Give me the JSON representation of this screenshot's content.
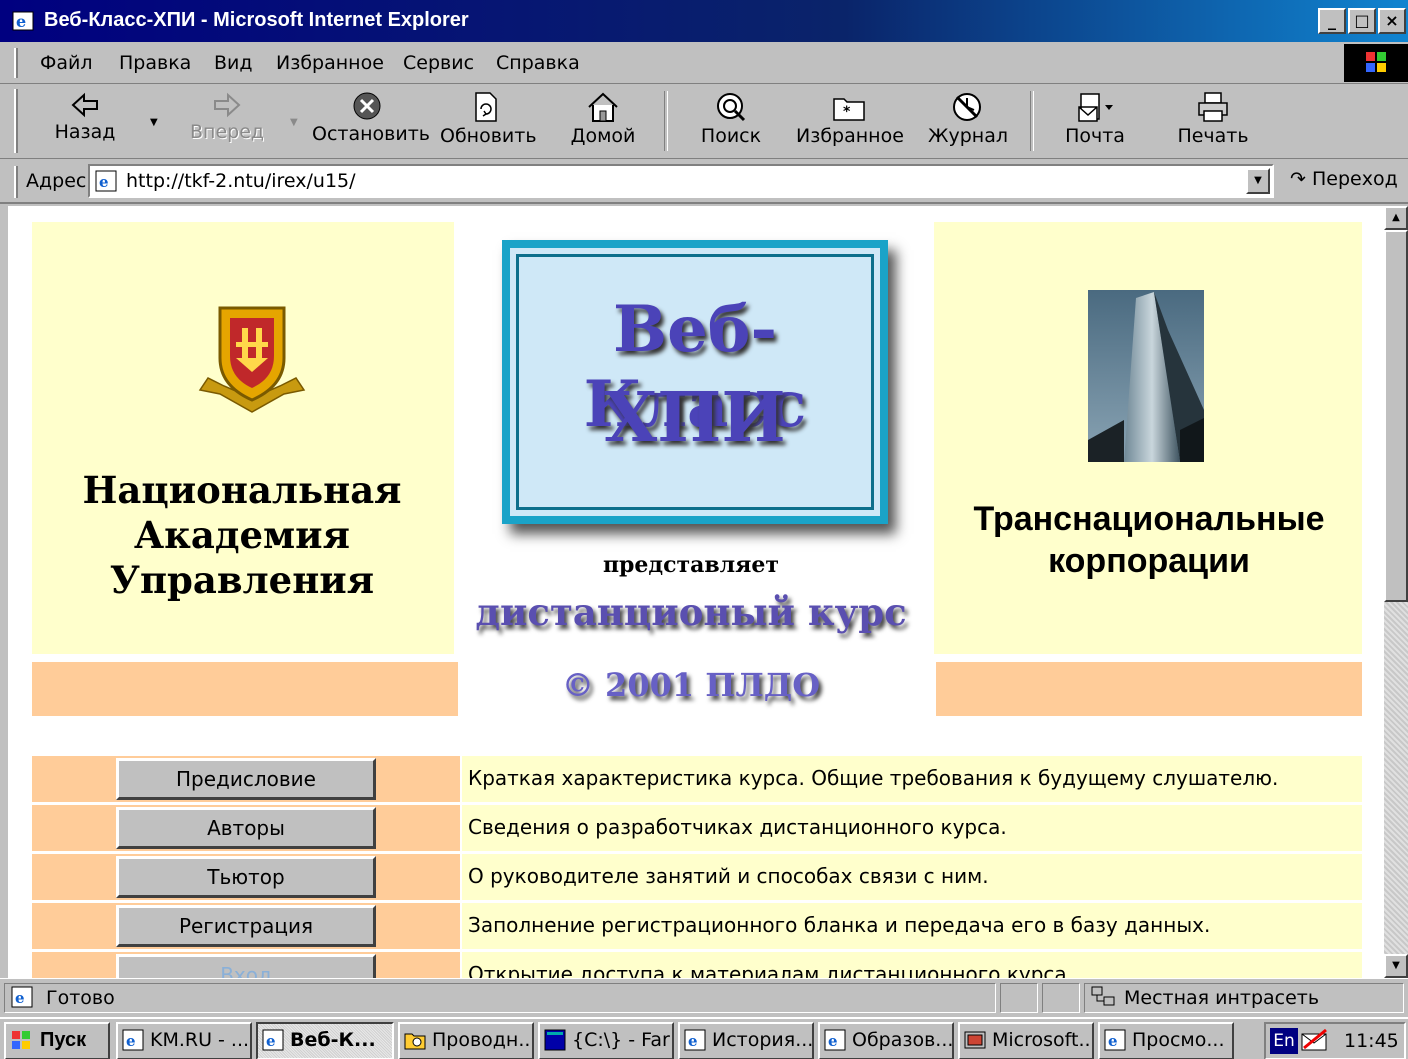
{
  "window": {
    "title": "Веб-Класс-ХПИ - Microsoft Internet Explorer",
    "controls": [
      "_",
      "□",
      "×"
    ]
  },
  "menu": [
    "Файл",
    "Правка",
    "Вид",
    "Избранное",
    "Сервис",
    "Справка"
  ],
  "toolbar": {
    "back": "Назад",
    "forward": "Вперед",
    "stop": "Остановить",
    "refresh": "Обновить",
    "home": "Домой",
    "search": "Поиск",
    "favorites": "Избранное",
    "history": "Журнал",
    "mail": "Почта",
    "print": "Печать"
  },
  "address": {
    "label": "Адрес",
    "url": "http://tkf-2.ntu/irex/u15/",
    "go": "Переход"
  },
  "page": {
    "org_name": [
      "Национальная",
      "Академия",
      "Управления"
    ],
    "logo_lines": [
      "Веб-Класс",
      "ХПИ"
    ],
    "presents": "представляет",
    "distance_course": "дистанционый курс",
    "copyright": "© 2001 ПЛДО",
    "course_name": [
      "Транснациональные",
      "корпорации"
    ],
    "nav": [
      {
        "label": "Предисловие",
        "description": "Краткая характеристика курса. Общие требования к будущему слушателю."
      },
      {
        "label": "Авторы",
        "description": "Сведения о разработчиках дистанционного курса."
      },
      {
        "label": "Тьютор",
        "description": "О руководителе занятий и способах связи с ним."
      },
      {
        "label": "Регистрация",
        "description": "Заполнение регистрационного бланка и передача его в базу данных."
      },
      {
        "label": "Вход",
        "description": "Открытие доступа к материалам дистанционного курса."
      }
    ],
    "colors": {
      "panel_yellow": "#ffffcc",
      "panel_peach": "#ffcc99",
      "logo_text": "#4b43b8",
      "logo_frame": "#1aa3c8"
    }
  },
  "status": {
    "text": "Готово",
    "zone": "Местная интрасеть"
  },
  "taskbar": {
    "start": "Пуск",
    "tasks": [
      {
        "label": "KM.RU - ...",
        "icon": "ie-icon"
      },
      {
        "label": "Веб-К...",
        "icon": "ie-icon",
        "active": true
      },
      {
        "label": "Проводн...",
        "icon": "explorer-icon"
      },
      {
        "label": "{C:\\} - Far",
        "icon": "far-icon"
      },
      {
        "label": "История...",
        "icon": "ie-icon"
      },
      {
        "label": "Образов...",
        "icon": "ie-icon"
      },
      {
        "label": "Microsoft...",
        "icon": "powerpoint-icon"
      },
      {
        "label": "Просмо...",
        "icon": "ie-icon"
      }
    ],
    "lang": "En",
    "clock": "11:45"
  }
}
